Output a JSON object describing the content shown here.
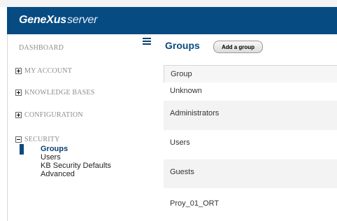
{
  "header": {
    "brand_bold": "GeneXus",
    "brand_light": "server"
  },
  "sidebar": {
    "dashboard": "DASHBOARD",
    "sections": [
      {
        "label": "MY ACCOUNT",
        "expanded": false
      },
      {
        "label": "KNOWLEDGE BASES",
        "expanded": false
      },
      {
        "label": "CONFIGURATION",
        "expanded": false
      },
      {
        "label": "SECURITY",
        "expanded": true
      }
    ],
    "security_items": [
      {
        "label": "Groups",
        "active": true
      },
      {
        "label": "Users",
        "active": false
      },
      {
        "label": "KB Security Defaults",
        "active": false
      },
      {
        "label": "Advanced",
        "active": false
      }
    ]
  },
  "main": {
    "title": "Groups",
    "add_button": "Add a group",
    "table": {
      "header": "Group",
      "rows": [
        "Unknown",
        "Administrators",
        "Users",
        "Guests",
        "Proy_01_ORT"
      ]
    }
  },
  "colors": {
    "header_bg": "#064b82",
    "accent": "#0a4a7e"
  },
  "icons": {
    "menu": "hamburger-icon",
    "collapsed": "plus-box-icon",
    "expanded": "minus-box-icon"
  }
}
